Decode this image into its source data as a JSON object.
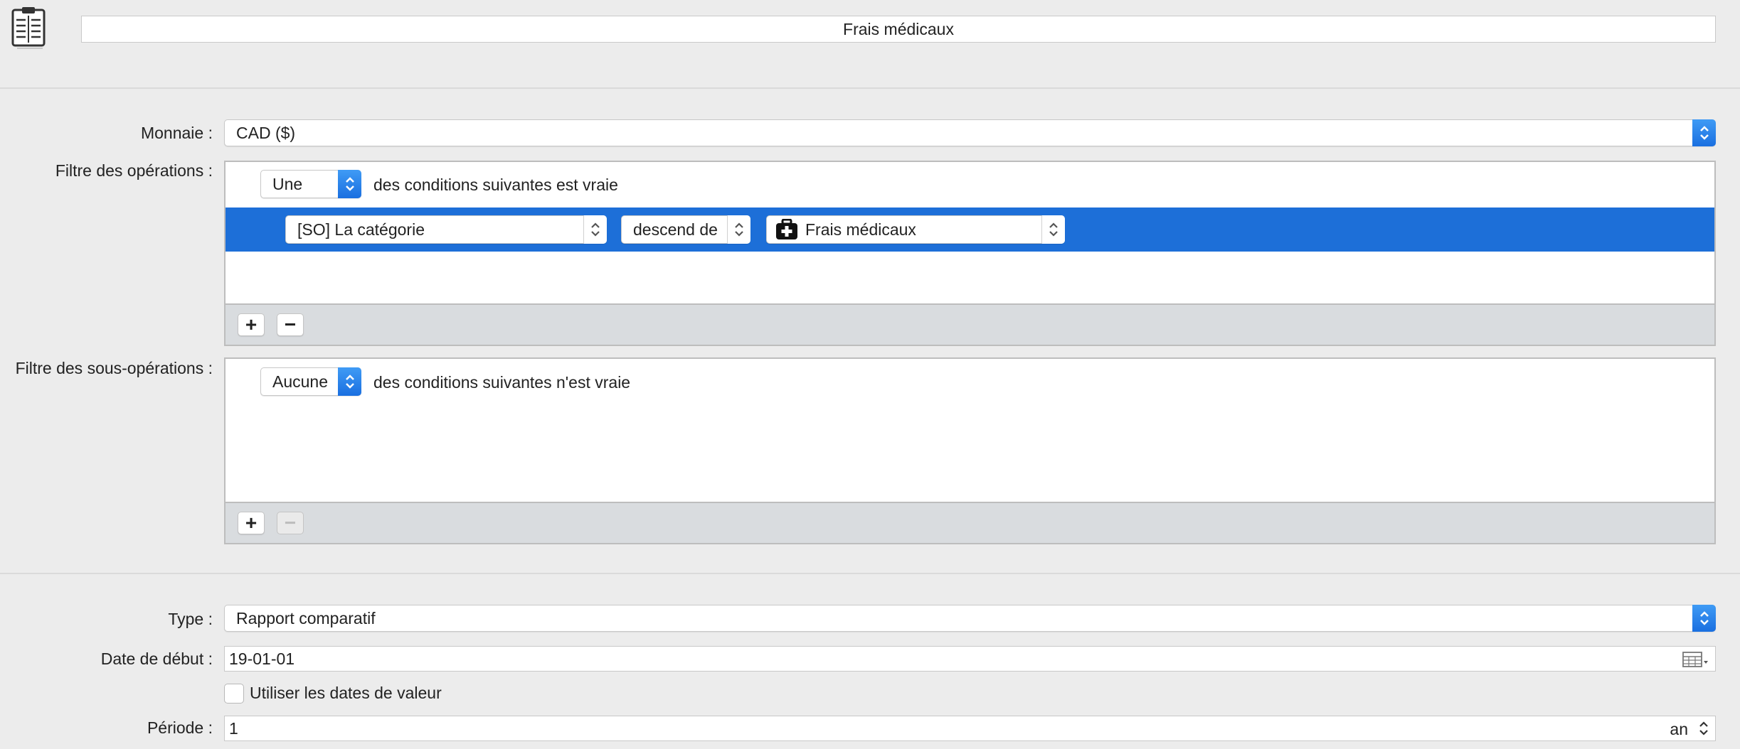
{
  "header": {
    "title": "Frais médicaux",
    "app_icon": "report-list-icon"
  },
  "currency": {
    "label": "Monnaie :",
    "value": "CAD ($)"
  },
  "operations_filter": {
    "label": "Filtre des opérations :",
    "quantifier": "Une",
    "condition_text": "des conditions suivantes est vraie",
    "rule": {
      "field": "[SO] La catégorie",
      "operator": "descend de",
      "category_icon": "medical-kit-icon",
      "value": "Frais médicaux"
    },
    "add_button": "+",
    "remove_button": "−"
  },
  "suboperations_filter": {
    "label": "Filtre des sous-opérations :",
    "quantifier": "Aucune",
    "condition_text": "des conditions suivantes n'est vraie",
    "add_button": "+",
    "remove_button": "−"
  },
  "type": {
    "label": "Type :",
    "value": "Rapport comparatif"
  },
  "start_date": {
    "label": "Date de début :",
    "value": "19-01-01",
    "icon": "calendar-icon"
  },
  "value_dates": {
    "label": "Utiliser les dates de valeur",
    "checked": false
  },
  "period": {
    "label": "Période :",
    "value": "1",
    "unit": "an"
  },
  "colors": {
    "accent": "#1d6fd8",
    "background": "#ececec",
    "footer": "#d9dcdf"
  }
}
